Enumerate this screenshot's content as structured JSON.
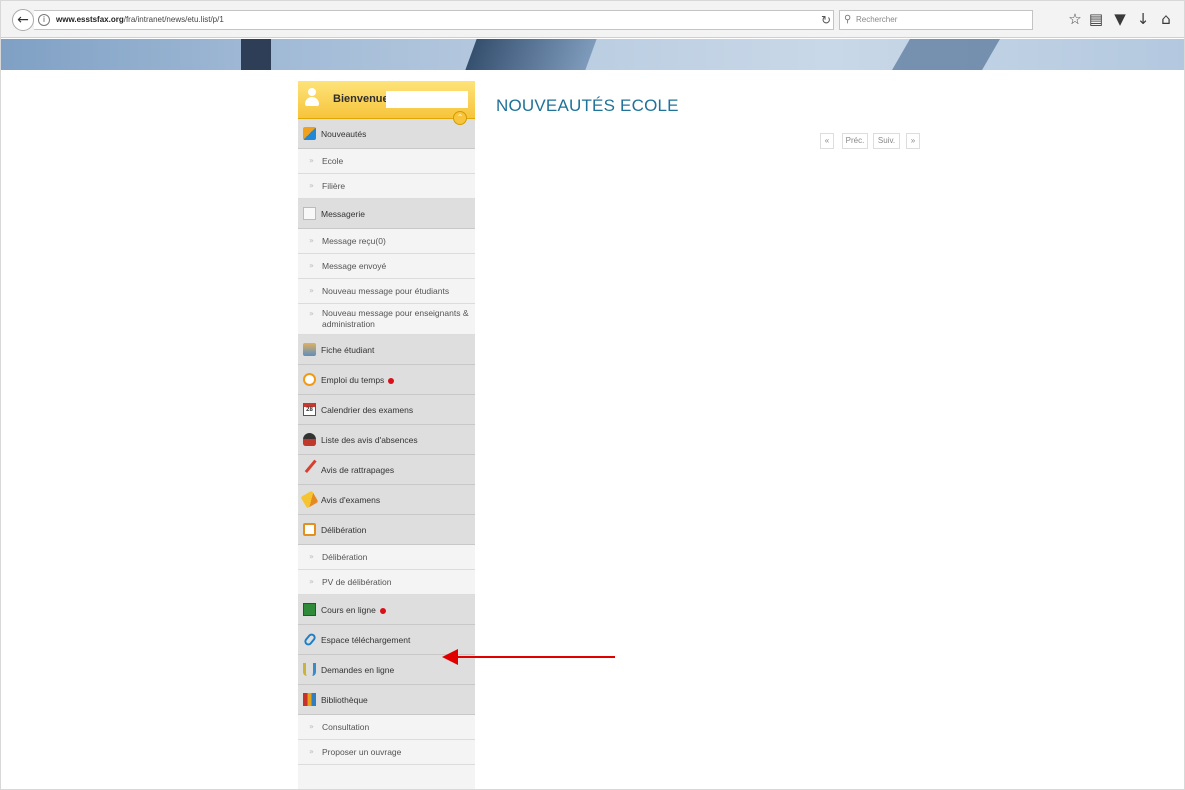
{
  "browser": {
    "url_host": "www.esstsfax.org",
    "url_path": "/fra/intranet/news/etu.list/p/1",
    "search_placeholder": "Rechercher",
    "icons": [
      "back-icon",
      "info-icon",
      "reload-icon",
      "search-icon",
      "star-icon",
      "reading-list-icon",
      "pocket-icon",
      "download-icon",
      "home-icon"
    ]
  },
  "sidebar": {
    "welcome": "Bienvenue",
    "items": [
      {
        "type": "section",
        "label": "Nouveautés",
        "icon": "news-icon"
      },
      {
        "type": "sub",
        "label": "Ecole"
      },
      {
        "type": "sub",
        "label": "Filière"
      },
      {
        "type": "section",
        "label": "Messagerie",
        "icon": "mail-icon"
      },
      {
        "type": "sub",
        "label": "Message reçu(0)"
      },
      {
        "type": "sub",
        "label": "Message envoyé"
      },
      {
        "type": "sub",
        "label": "Nouveau message pour étudiants"
      },
      {
        "type": "sub",
        "label": "Nouveau message pour enseignants & administration"
      },
      {
        "type": "section",
        "label": "Fiche étudiant",
        "icon": "student-icon"
      },
      {
        "type": "section",
        "label": "Emploi du temps",
        "icon": "clock-icon",
        "alert": true
      },
      {
        "type": "section",
        "label": "Calendrier des examens",
        "icon": "calendar-icon",
        "icon_text": "28"
      },
      {
        "type": "section",
        "label": "Liste des avis d'absences",
        "icon": "absence-icon"
      },
      {
        "type": "section",
        "label": "Avis de rattrapages",
        "icon": "pin-icon"
      },
      {
        "type": "section",
        "label": "Avis d'examens",
        "icon": "exam-icon"
      },
      {
        "type": "section",
        "label": "Délibération",
        "icon": "deliberation-icon"
      },
      {
        "type": "sub",
        "label": "Délibération"
      },
      {
        "type": "sub",
        "label": "PV de délibération"
      },
      {
        "type": "section",
        "label": "Cours en ligne",
        "icon": "board-icon",
        "alert": true
      },
      {
        "type": "section",
        "label": "Espace téléchargement",
        "icon": "paperclip-icon"
      },
      {
        "type": "section",
        "label": "Demandes en ligne",
        "icon": "form-icon"
      },
      {
        "type": "section",
        "label": "Bibliothèque",
        "icon": "books-icon"
      },
      {
        "type": "sub",
        "label": "Consultation"
      },
      {
        "type": "sub",
        "label": "Proposer un ouvrage"
      }
    ]
  },
  "content": {
    "title": "NOUVEAUTÉS ECOLE",
    "pager": {
      "first": "«",
      "prev": "Préc.",
      "next": "Suiv.",
      "last": "»"
    }
  },
  "annotation": {
    "color": "#e00000",
    "target": "Espace téléchargement"
  }
}
